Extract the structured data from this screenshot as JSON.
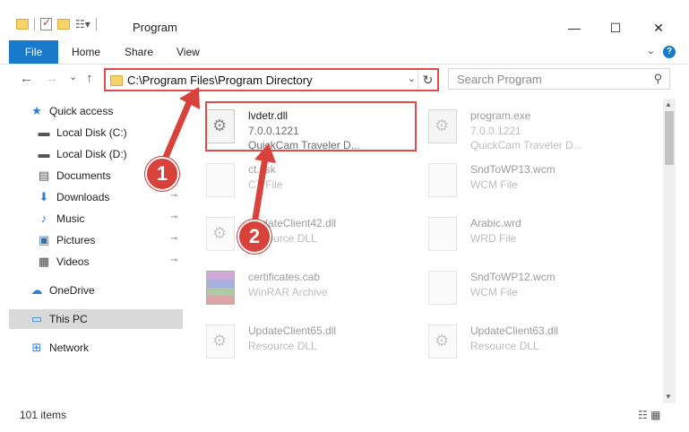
{
  "window": {
    "title": "Program",
    "minimize": "—",
    "maximize": "☐",
    "close": "✕"
  },
  "ribbon": {
    "file": "File",
    "tabs": [
      "Home",
      "Share",
      "View"
    ],
    "help": "?"
  },
  "nav": {
    "back": "←",
    "forward": "→",
    "recent": "⌄",
    "up": "↑",
    "address": "C:\\Program Files\\Program Directory",
    "refresh": "↻",
    "search_placeholder": "Search Program"
  },
  "sidebar": {
    "items": [
      {
        "label": "Quick access",
        "icon": "star-icon",
        "glyph": "★",
        "color": "#2b7fd8"
      },
      {
        "label": "Local Disk (C:)",
        "icon": "drive-icon",
        "glyph": "▬",
        "color": "#555"
      },
      {
        "label": "Local Disk (D:)",
        "icon": "drive-icon",
        "glyph": "▬",
        "color": "#555"
      },
      {
        "label": "Documents",
        "icon": "documents-icon",
        "glyph": "▤",
        "color": "#555"
      },
      {
        "label": "Downloads",
        "icon": "download-icon",
        "glyph": "⬇",
        "color": "#2b7fd8"
      },
      {
        "label": "Music",
        "icon": "music-icon",
        "glyph": "♪",
        "color": "#2b7fd8"
      },
      {
        "label": "Pictures",
        "icon": "pictures-icon",
        "glyph": "▣",
        "color": "#3a6ea5"
      },
      {
        "label": "Videos",
        "icon": "videos-icon",
        "glyph": "▦",
        "color": "#444"
      },
      {
        "label": "OneDrive",
        "icon": "cloud-icon",
        "glyph": "☁",
        "color": "#2b7fd8"
      },
      {
        "label": "This PC",
        "icon": "computer-icon",
        "glyph": "▭",
        "color": "#2b7fd8"
      },
      {
        "label": "Network",
        "icon": "network-icon",
        "glyph": "⊞",
        "color": "#2b7fd8"
      }
    ],
    "pin": "📌"
  },
  "files": {
    "items": [
      {
        "name": "lvdetr.dll",
        "line2": "7.0.0.1221",
        "line3": "QuickCam Traveler D...",
        "icon": "dll-icon"
      },
      {
        "name": "program.exe",
        "line2": "7.0.0.1221",
        "line3": "QuickCam Traveler D...",
        "icon": "exe-icon"
      },
      {
        "name": "ct.tlsk",
        "line2": "CT File",
        "line3": "",
        "icon": "file-icon"
      },
      {
        "name": "SndToWP13.wcm",
        "line2": "WCM File",
        "line3": "",
        "icon": "file-icon"
      },
      {
        "name": "UpdateClient42.dll",
        "line2": "Resource DLL",
        "line3": "",
        "icon": "dll-icon"
      },
      {
        "name": "Arabic.wrd",
        "line2": "WRD File",
        "line3": "",
        "icon": "file-icon"
      },
      {
        "name": "certificates.cab",
        "line2": "WinRAR Archive",
        "line3": "",
        "icon": "rar-icon"
      },
      {
        "name": "SndToWP12.wcm",
        "line2": "WCM File",
        "line3": "",
        "icon": "file-icon"
      },
      {
        "name": "UpdateClient65.dll",
        "line2": "Resource DLL",
        "line3": "",
        "icon": "dll-icon"
      },
      {
        "name": "UpdateClient63.dll",
        "line2": "Resource DLL",
        "line3": "",
        "icon": "dll-icon"
      }
    ]
  },
  "status": {
    "count": "101 items",
    "view_icons": "☷ ▦"
  },
  "callouts": [
    "1",
    "2"
  ],
  "colors": {
    "accent": "#1979ca",
    "highlight": "#e04a4a",
    "callout": "#d9413b"
  }
}
